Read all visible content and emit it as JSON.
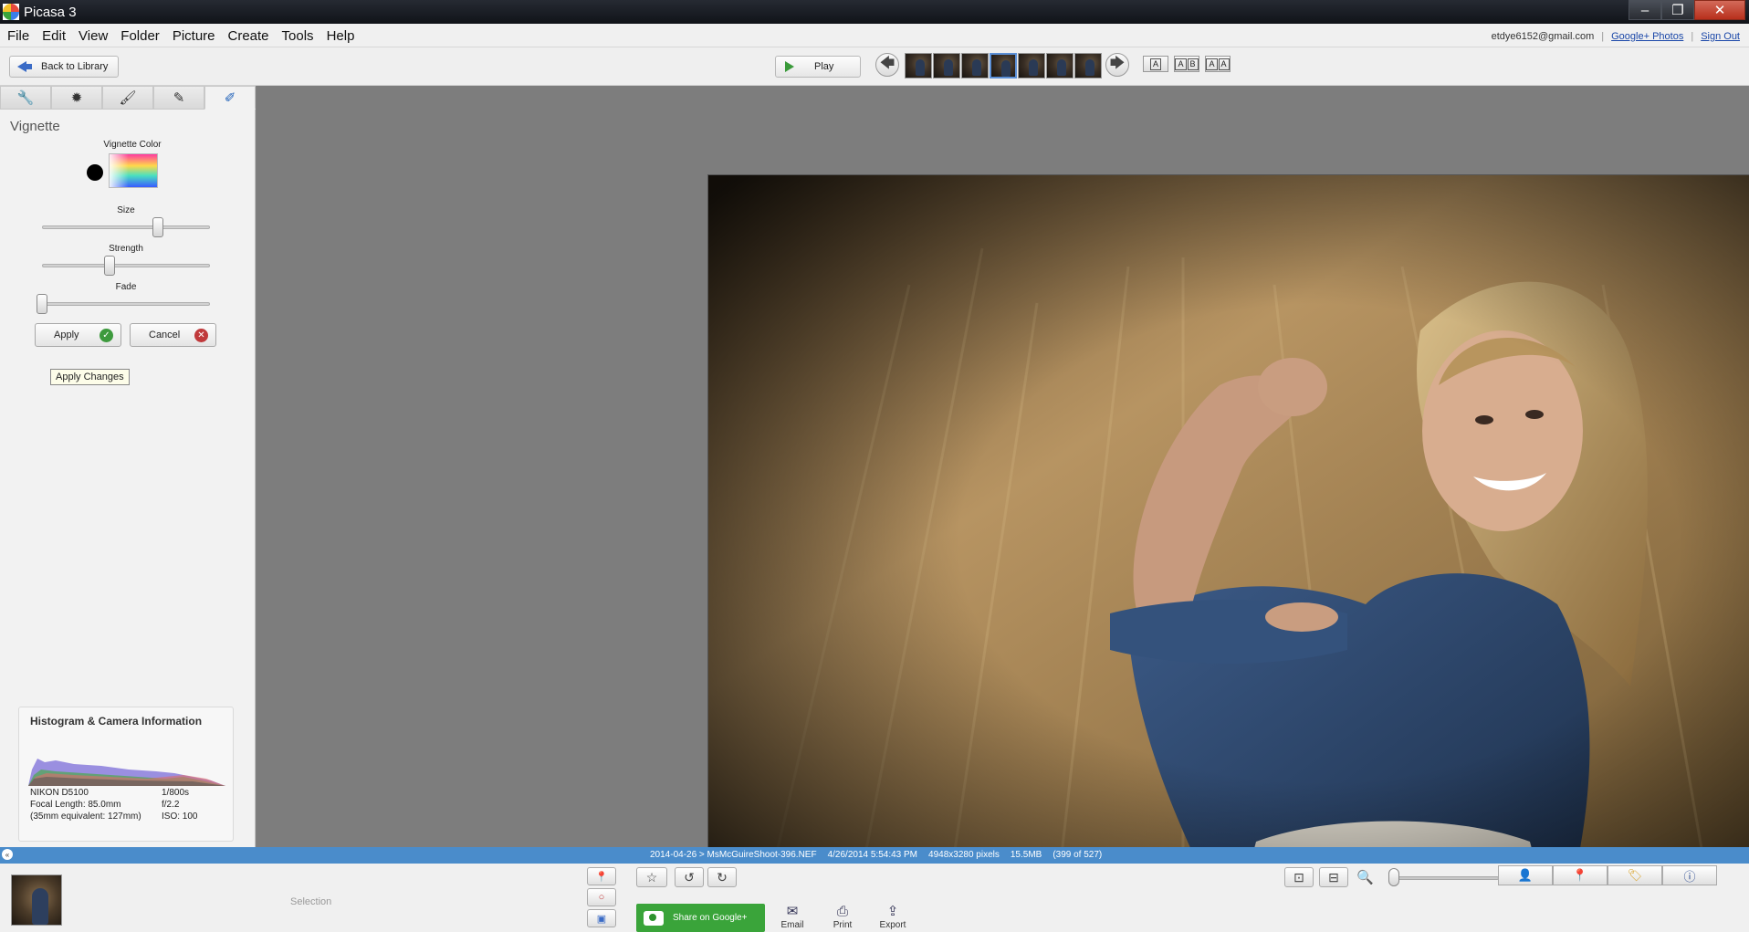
{
  "window": {
    "title": "Picasa 3"
  },
  "menu": [
    "File",
    "Edit",
    "View",
    "Folder",
    "Picture",
    "Create",
    "Tools",
    "Help"
  ],
  "account": {
    "email": "etdye6152@gmail.com",
    "google_photos": "Google+ Photos",
    "sign_out": "Sign Out"
  },
  "toolbar": {
    "back_label": "Back to Library",
    "play_label": "Play",
    "thumb_count": 7,
    "selected_thumb": 4
  },
  "edit_panel": {
    "active_tab": "vignette-tab",
    "title": "Vignette",
    "color_label": "Vignette Color",
    "vignette_color": "#000000",
    "sliders": [
      {
        "label": "Size",
        "value_fraction": 0.69
      },
      {
        "label": "Strength",
        "value_fraction": 0.4
      },
      {
        "label": "Fade",
        "value_fraction": 0.0
      }
    ],
    "apply_label": "Apply",
    "cancel_label": "Cancel",
    "tooltip": "Apply Changes"
  },
  "histogram": {
    "title": "Histogram & Camera Information",
    "camera": "NIKON D5100",
    "focal_length": "Focal Length: 85.0mm",
    "equivalent": "(35mm equivalent: 127mm)",
    "shutter": "1/800s",
    "aperture": "f/2.2",
    "iso": "ISO: 100"
  },
  "status": {
    "path": "2014-04-26 > MsMcGuireShoot-396.NEF",
    "date": "4/26/2014 5:54:43 PM",
    "dimensions": "4948x3280 pixels",
    "size": "15.5MB",
    "position": "(399 of 527)"
  },
  "tray": {
    "selection_label": "Selection",
    "share_label": "Share on Google+",
    "email_label": "Email",
    "print_label": "Print",
    "export_label": "Export"
  },
  "colors": {
    "status_blue": "#4a8ccb",
    "share_green": "#3aa43a"
  }
}
